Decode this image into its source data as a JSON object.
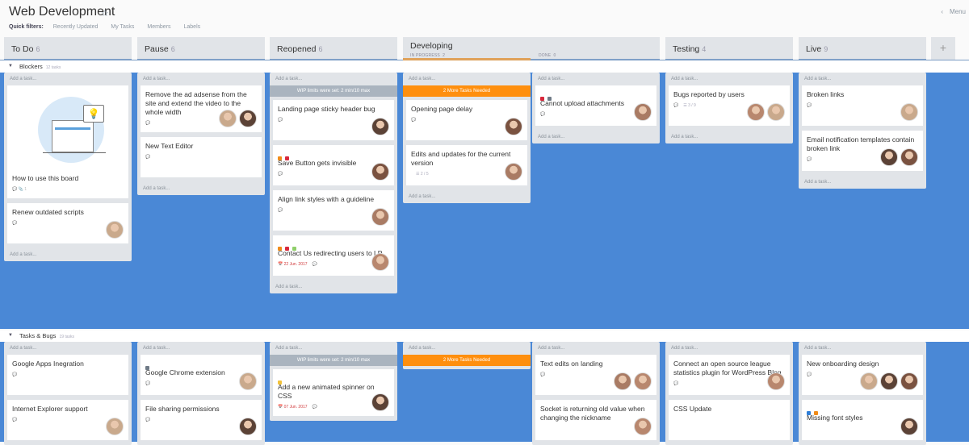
{
  "header": {
    "title": "Web Development",
    "star_icon": "☆",
    "quick_filters_label": "Quick filters:",
    "filters": [
      "Recently Updated",
      "My Tasks",
      "Members",
      "Labels"
    ],
    "menu_label": "Menu",
    "menu_icon": "‹"
  },
  "columns": [
    {
      "name": "To Do",
      "count": "6"
    },
    {
      "name": "Pause",
      "count": "6"
    },
    {
      "name": "Reopened",
      "count": "6"
    },
    {
      "name": "Developing",
      "count": "",
      "sub": [
        {
          "label": "IN PROGRESS",
          "count": "2"
        },
        {
          "label": "DONE",
          "count": "0"
        }
      ]
    },
    {
      "name": "Testing",
      "count": "4"
    },
    {
      "name": "Live",
      "count": "9"
    }
  ],
  "add_column_icon": "+",
  "add_task_label": "Add a task...",
  "wip_banner": "WIP limits were set: 2 min/10 max",
  "more_banner": "2 More Tasks Needed",
  "colors": {
    "board": "#4a88d6",
    "orange": "#ff8f0e",
    "red": "#d8283c",
    "gray": "#6f7a86",
    "green": "#8fcf6a",
    "yellow": "#f2c23a",
    "blue": "#2f7ed8",
    "amber": "#f08c1a"
  },
  "lanes": [
    {
      "name": "Blockers",
      "count": "12 tasks",
      "lists": [
        {
          "cards": [
            {
              "title": "How to use this board",
              "illustration": true,
              "meta": "💬  📎 1"
            },
            {
              "title": "Renew outdated scripts",
              "meta": "💬",
              "avatars": 1
            }
          ],
          "bottom_add": true
        },
        {
          "cards": [
            {
              "title": "Remove the ad adsense from the site and extend the video to the whole width",
              "meta": "💬",
              "avatars": 2
            },
            {
              "title": "New Text Editor",
              "meta": "💬"
            }
          ],
          "bottom_add": true
        },
        {
          "banner": "wip",
          "cards": [
            {
              "title": "Landing page sticky header bug",
              "meta": "💬",
              "avatars": 1
            },
            {
              "title": "Save Button gets invisible",
              "labels": [
                "#f08c1a",
                "#d8283c"
              ],
              "meta": "💬",
              "avatars": 1
            },
            {
              "title": "Align link styles with a guideline",
              "meta": "💬",
              "avatars": 1
            },
            {
              "title": "Contact Us redirecting users to LP",
              "labels": [
                "#f08c1a",
                "#d8283c",
                "#8fcf6a"
              ],
              "date": "22 Jun. 2017",
              "meta": "💬",
              "avatars": 1
            }
          ],
          "bottom_add": true
        },
        {
          "banner": "more",
          "cards": [
            {
              "title": "Opening page delay",
              "meta": "💬",
              "avatars": 1
            },
            {
              "title": "Edits and updates for the current version",
              "checklist": "2 / 5",
              "avatars": 1
            }
          ],
          "bottom_add": true
        },
        {
          "cards": [
            {
              "title": "Cannot upload attachments",
              "labels": [
                "#d8283c",
                "#6f7a86"
              ],
              "meta": "💬",
              "avatars": 1
            }
          ],
          "bottom_add": true
        },
        {
          "cards": [
            {
              "title": "Bugs reported by users",
              "meta": "💬",
              "checklist": "3 / 9",
              "avatars": 2
            }
          ],
          "bottom_add": true
        },
        {
          "cards": [
            {
              "title": "Broken links",
              "meta": "💬",
              "avatars": 1
            },
            {
              "title": "Email notification templates contain broken link",
              "meta": "💬",
              "avatars": 2
            }
          ],
          "bottom_add": true
        }
      ]
    },
    {
      "name": "Tasks & Bugs",
      "count": "19 tasks",
      "lists": [
        {
          "cards": [
            {
              "title": "Google Apps Inegration",
              "meta": "💬"
            },
            {
              "title": "Internet Explorer support",
              "meta": "💬",
              "avatars": 1
            }
          ]
        },
        {
          "cards": [
            {
              "title": "Google Chrome extension",
              "labels": [
                "#6f7a86"
              ],
              "meta": "💬",
              "avatars": 1
            },
            {
              "title": "File sharing permissions",
              "meta": "💬",
              "avatars": 1
            }
          ]
        },
        {
          "banner": "wip",
          "cards": [
            {
              "title": "Add a new animated spinner on CSS",
              "labels": [
                "#f2c23a"
              ],
              "date": "07 Jun. 2017",
              "meta": "💬",
              "avatars": 1
            }
          ]
        },
        {
          "banner": "more",
          "cards": []
        },
        {
          "cards": [
            {
              "title": "Text edits on landing",
              "meta": "💬",
              "avatars": 2
            },
            {
              "title": "Socket is returning old value when changing the nickname",
              "avatars": 1
            }
          ]
        },
        {
          "cards": [
            {
              "title": "Connect an open source league statistics plugin for WordPress Blog",
              "meta": "💬",
              "avatars": 1
            },
            {
              "title": "CSS Update"
            }
          ]
        },
        {
          "cards": [
            {
              "title": "New onboarding design",
              "meta": "💬",
              "avatars": 3
            },
            {
              "title": "Missing font styles",
              "labels": [
                "#2f7ed8",
                "#f08c1a"
              ],
              "avatars": 1
            }
          ]
        }
      ]
    }
  ]
}
